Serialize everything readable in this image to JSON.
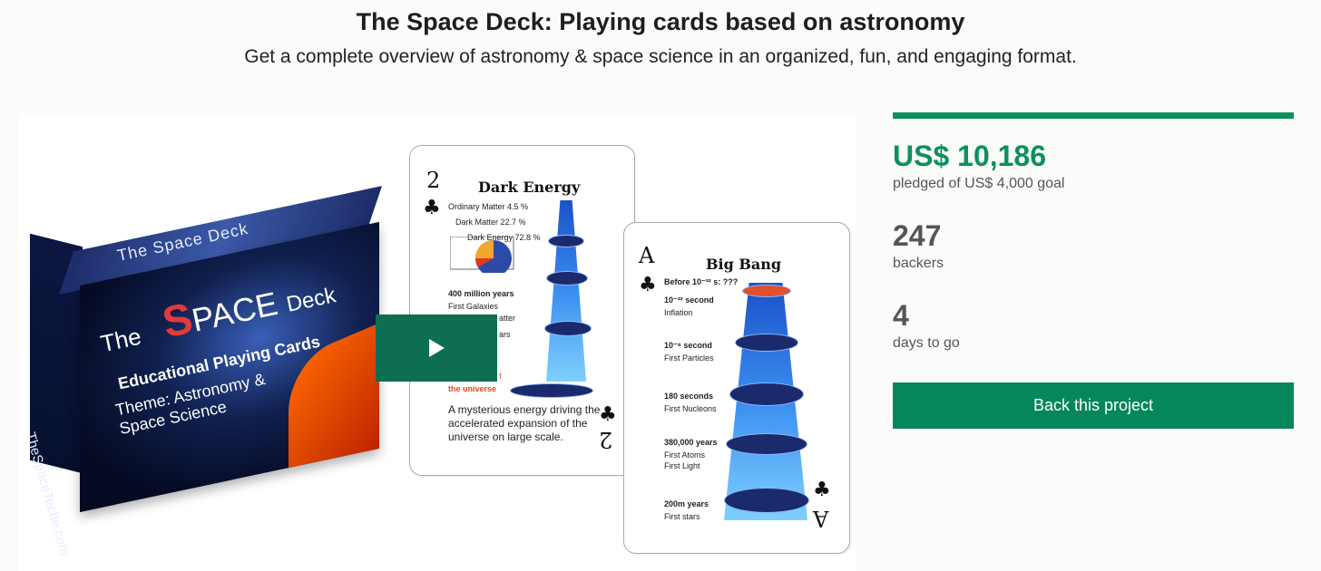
{
  "header": {
    "title": "The Space Deck: Playing cards based on astronomy",
    "subtitle": "Get a complete overview of astronomy & space science in an organized, fun, and engaging format."
  },
  "media": {
    "box": {
      "top_label": "The Space Deck",
      "the": "The",
      "space_s": "S",
      "space_rest": "PACE",
      "deck": "Deck",
      "edu": "Educational Playing Cards",
      "theme_line1": "Theme: Astronomy &",
      "theme_line2": "Space Science",
      "side_label": "TheSpaceTeche.com"
    },
    "card_dark_energy": {
      "rank": "2",
      "rank_flipped": "2",
      "title": "Dark Energy",
      "ordinary": "Ordinary Matter 4.5 %",
      "dark_matter": "Dark Matter 22.7 %",
      "dark_energy": "Dark Energy 72.8 %",
      "milestone_1_time": "400 million years",
      "milestone_1_label": "First Galaxies",
      "partial_1": "atter",
      "partial_2": "ars",
      "partial_3": "f",
      "partial_4": "the universe",
      "description": "A mysterious energy driving the accelerated expansion of the universe on large scale."
    },
    "card_big_bang": {
      "rank": "A",
      "rank_flipped": "A",
      "title": "Big Bang",
      "before": "Before 10⁻³² s: ???",
      "m1_time": "10⁻³² second",
      "m1_label": "Inflation",
      "m2_time": "10⁻⁶ second",
      "m2_label": "First Particles",
      "m3_time": "180 seconds",
      "m3_label": "First Nucleons",
      "m4_time": "380,000 years",
      "m4_label1": "First Atoms",
      "m4_label2": "First Light",
      "m5_time": "200m years",
      "m5_label": "First stars"
    },
    "play_icon": "play-icon"
  },
  "campaign": {
    "pledged_amount": "US$ 10,186",
    "pledged_label": "pledged of US$ 4,000 goal",
    "backers": "247",
    "backers_label": "backers",
    "days": "4",
    "days_label": "days to go",
    "progress_fraction": 1.0,
    "back_button": "Back this project",
    "accent_color": "#0d8f5e"
  }
}
